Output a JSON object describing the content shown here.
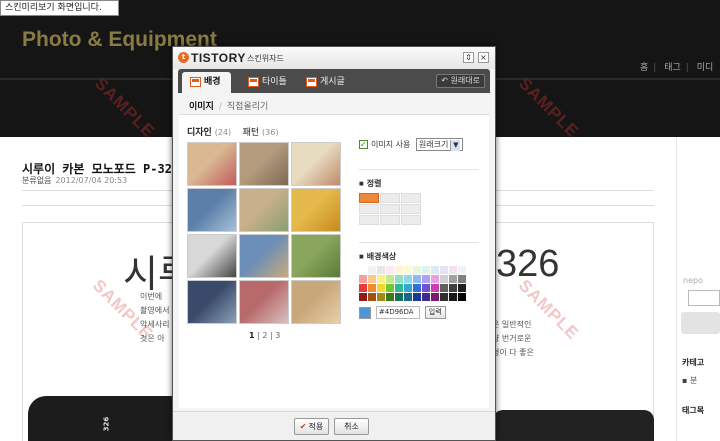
{
  "preview_notice": "스킨미리보기 화면입니다.",
  "site": {
    "title": "Photo & Equipment",
    "nav": [
      "홈",
      "태그",
      "미디"
    ],
    "watermark": "SAMPLE"
  },
  "post": {
    "title": "시루이 카본 모노포드 P-326",
    "category": "분류없음",
    "date": "2012/07/04 20:53",
    "big_title_left": "시루",
    "big_title_right": "326",
    "body_left": [
      "이번에",
      "촬영에서",
      "악세사리",
      "것은 아"
    ],
    "body_right": [
      "은 일반적인",
      "냥 번거로운",
      "경이 다 좋은"
    ],
    "tripod_label": "326"
  },
  "sidebar": {
    "nepo": "nepo",
    "category_title": "카테고",
    "category_item": "분",
    "tag_title": "태그목"
  },
  "dialog": {
    "logo": "TISTORY",
    "wizard_label": "스킨위자드",
    "pin_label": "\u0000",
    "close_label": "×",
    "tabs": [
      {
        "label": "배경",
        "active": true
      },
      {
        "label": "타이틀",
        "active": false
      },
      {
        "label": "게시글",
        "active": false
      }
    ],
    "revert_label": "원래대로",
    "subtabs": {
      "image": "이미지",
      "upload": "직접올리기"
    },
    "design_label": "디자인",
    "design_count": "(24)",
    "pattern_label": "패턴",
    "pattern_count": "(36)",
    "pager": [
      "1",
      "2",
      "3"
    ],
    "use_image_label": "이미지 사용",
    "size_option": "원래크기",
    "align_title": "정렬",
    "bg_color_title": "배경색상",
    "hex_value": "#4D96DA",
    "input_button": "입력",
    "apply_button": "적용",
    "cancel_button": "취소",
    "accent_color": "#4D96DA"
  },
  "thumb_colors": [
    [
      "#d9b892",
      "#c45a5a"
    ],
    [
      "#b39b7c",
      "#7c6a55"
    ],
    [
      "#e8dcc0",
      "#c08a6a"
    ],
    [
      "#5b7fa8",
      "#a8c0d8"
    ],
    [
      "#c7b08a",
      "#8a9f6f"
    ],
    [
      "#e4b84a",
      "#c98a1e"
    ],
    [
      "#d8d8d8",
      "#444444"
    ],
    [
      "#6b8fb8",
      "#c9a87a"
    ],
    [
      "#8aa65c",
      "#5a7a3a"
    ],
    [
      "#3a4a6a",
      "#8aa0b8"
    ],
    [
      "#b86a6a",
      "#d8c0c0"
    ],
    [
      "#c8a87a",
      "#e8d0a8"
    ]
  ],
  "palette_colors": [
    "#ffffff",
    "#f2f2f2",
    "#e6e6e6",
    "#fde9e9",
    "#fff5d6",
    "#fbfbd0",
    "#e6f7d9",
    "#d9f2f2",
    "#dde8f7",
    "#e8e0f5",
    "#f5e0f0",
    "#f2f2f2",
    "#f4a0a0",
    "#f8c890",
    "#f8f090",
    "#c0e890",
    "#90e0c0",
    "#90d8e8",
    "#90b8f0",
    "#b0a0f0",
    "#e8a0e0",
    "#d0d0d0",
    "#a0a0a0",
    "#808080",
    "#e83a3a",
    "#f08a30",
    "#f0d830",
    "#70c830",
    "#30b890",
    "#30a8d0",
    "#3070d8",
    "#7050d8",
    "#c840b0",
    "#606060",
    "#404040",
    "#202020",
    "#901818",
    "#a05010",
    "#a08a10",
    "#3a7a18",
    "#187058",
    "#186888",
    "#183a90",
    "#402890",
    "#7a1a6a",
    "#303030",
    "#181818",
    "#000000"
  ]
}
